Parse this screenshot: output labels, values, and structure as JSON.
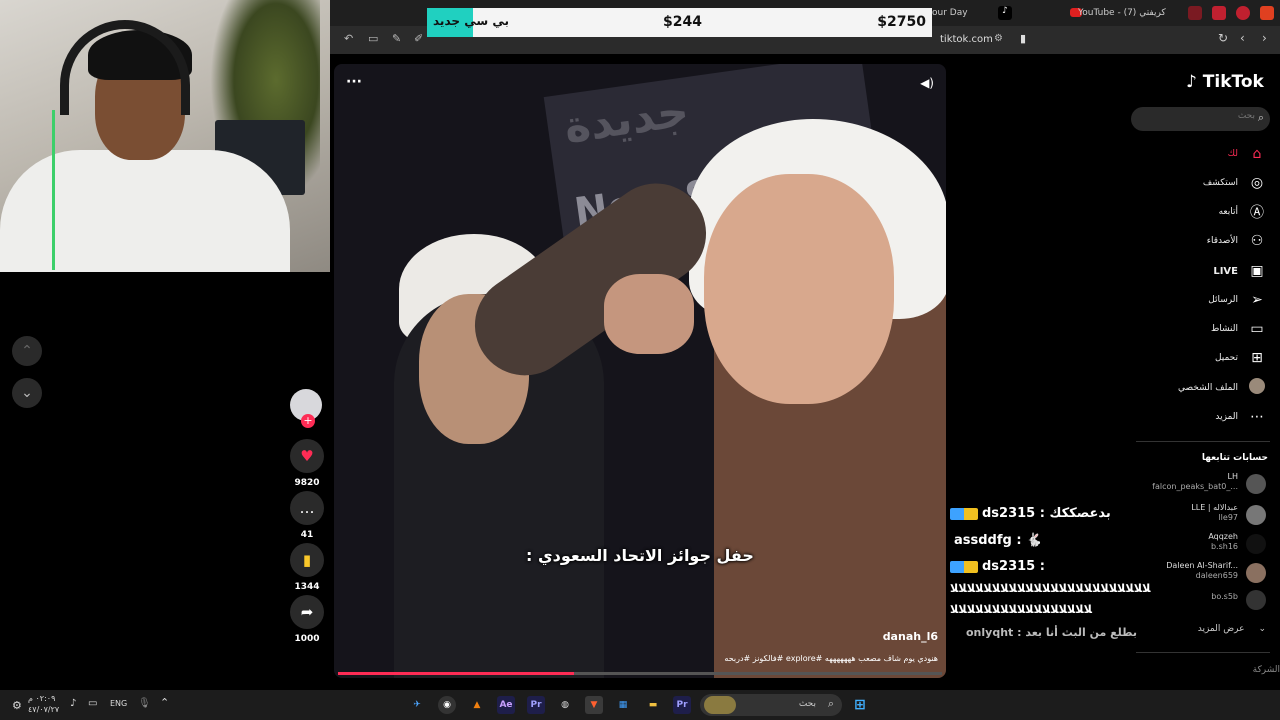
{
  "price_overlay": {
    "badge": "بي سي جديد",
    "price_middle": "$244",
    "price_right": "$2750"
  },
  "browser": {
    "tab_partial": "our Day",
    "tab_youtube": "YouTube - (7) كريفتي",
    "url": "tiktok.com"
  },
  "video": {
    "caption": "حفل جوائز الاتحاد السعودي :",
    "author": "danah_l6",
    "description": "هنودي يوم شاف مصعب هههههههه #explore #فالكونز #دربحه",
    "progress": 0.39,
    "sign_en": "New Sa",
    "sign_ar": "جديدة"
  },
  "actions": {
    "likes": "9820",
    "comments": "41",
    "saves": "1344",
    "shares": "1000"
  },
  "tiktok": {
    "logo": "TikTok",
    "search_placeholder": "بحث",
    "nav": [
      {
        "label": "لك",
        "icon": "home-icon"
      },
      {
        "label": "استكشف",
        "icon": "compass-icon"
      },
      {
        "label": "أتابعه",
        "icon": "following-icon"
      },
      {
        "label": "الأصدقاء",
        "icon": "friends-icon"
      },
      {
        "label": "LIVE",
        "icon": "live-icon"
      },
      {
        "label": "الرسائل",
        "icon": "messages-icon"
      },
      {
        "label": "النشاط",
        "icon": "activity-icon"
      },
      {
        "label": "تحميل",
        "icon": "upload-icon"
      },
      {
        "label": "الملف الشخصي",
        "icon": "profile-icon"
      },
      {
        "label": "المزيد",
        "icon": "more-icon"
      }
    ],
    "following_title": "حسابات تتابعها",
    "accounts": [
      {
        "name": "LH",
        "user": "falcon_peaks_bat0_..."
      },
      {
        "name": "LLE | عبدالاله",
        "user": "lle97"
      },
      {
        "name": "Aqqzeh",
        "user": "b.sh16"
      },
      {
        "name": "Daleen Al-Sharif...",
        "user": "daleen659"
      },
      {
        "name": "",
        "user": "bo.s5b"
      }
    ],
    "see_more": "عرض المزيد",
    "footer_partial": "الشركة"
  },
  "chat": [
    {
      "user": "ds2315",
      "msg": "بدعصككك"
    },
    {
      "user": "assddfg",
      "msg": "🐇"
    },
    {
      "user": "ds2315",
      "msg": ""
    },
    {
      "user": "",
      "msg": "ﻼﻼﻼﻼﻼﻼﻼﻼﻼﻼﻼﻼﻼﻼﻼﻼﻼﻼﻼﻼﻼﻼﻼﻼ"
    },
    {
      "user": "",
      "msg": "ﻼﻼﻼﻼﻼﻼﻼﻼﻼﻼﻼﻼﻼﻼﻼﻼﻼ"
    },
    {
      "user": "onlyqht",
      "msg": "بطلع من البث أنا بعد"
    }
  ],
  "taskbar": {
    "time": "٠٢:٠٩ م",
    "date": "٤٧/٠٧/٢٧",
    "lang": "ENG",
    "search": "بحث"
  }
}
